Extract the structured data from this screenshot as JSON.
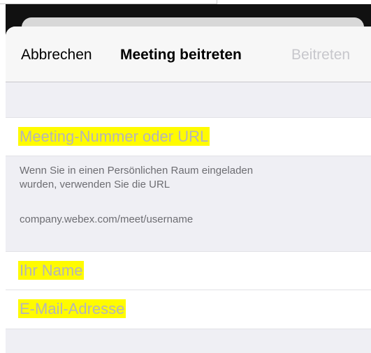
{
  "navbar": {
    "cancel_label": "Abbrechen",
    "title": "Meeting beitreten",
    "join_label": "Beitreten"
  },
  "form": {
    "meeting_field": {
      "placeholder": "Meeting-Nummer oder URL"
    },
    "hint": {
      "line1": "Wenn Sie in einen Persönlichen Raum eingeladen",
      "line2": "wurden, verwenden Sie die URL",
      "example": "company.webex.com/meet/username"
    },
    "name_field": {
      "placeholder": "Ihr Name"
    },
    "email_field": {
      "placeholder": "E-Mail-Adresse"
    }
  },
  "colors": {
    "highlight": "#fffb00",
    "disabled_text": "#c7c7cc",
    "placeholder_text": "#b5b5ba",
    "grouped_background": "#efeff4"
  }
}
